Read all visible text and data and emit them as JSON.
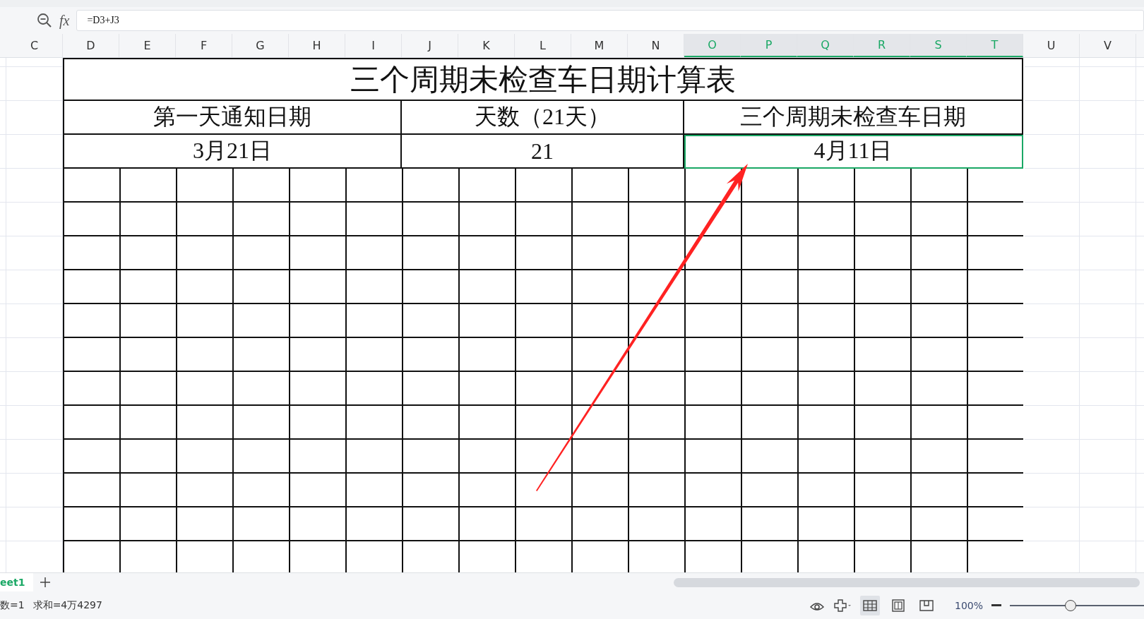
{
  "formula_bar": {
    "function_label": "fx",
    "formula": "=D3+J3"
  },
  "columns": [
    {
      "label": "C",
      "selected": false
    },
    {
      "label": "D",
      "selected": false
    },
    {
      "label": "E",
      "selected": false
    },
    {
      "label": "F",
      "selected": false
    },
    {
      "label": "G",
      "selected": false
    },
    {
      "label": "H",
      "selected": false
    },
    {
      "label": "I",
      "selected": false
    },
    {
      "label": "J",
      "selected": false
    },
    {
      "label": "K",
      "selected": false
    },
    {
      "label": "L",
      "selected": false
    },
    {
      "label": "M",
      "selected": false
    },
    {
      "label": "N",
      "selected": false
    },
    {
      "label": "O",
      "selected": true
    },
    {
      "label": "P",
      "selected": true
    },
    {
      "label": "Q",
      "selected": true
    },
    {
      "label": "R",
      "selected": true
    },
    {
      "label": "S",
      "selected": true
    },
    {
      "label": "T",
      "selected": true
    },
    {
      "label": "U",
      "selected": false
    },
    {
      "label": "V",
      "selected": false
    }
  ],
  "title": "三个周期未检查车日期计算表",
  "headers": [
    "第一天通知日期",
    "天数（21天）",
    "三个周期未检查车日期"
  ],
  "values": [
    {
      "text": "3月21日",
      "selected": false
    },
    {
      "text": "21",
      "selected": false
    },
    {
      "text": "4月11日",
      "selected": true
    }
  ],
  "sheet_tabs": [
    {
      "label": "eet1",
      "selected": true
    }
  ],
  "status": [
    "数=1",
    "求和=4万4297"
  ],
  "views": [
    {
      "kind": "normal",
      "selected": true
    },
    {
      "kind": "split",
      "selected": false
    },
    {
      "kind": "page",
      "selected": false
    }
  ],
  "zoom": {
    "text": "100%",
    "level": 0.45
  }
}
